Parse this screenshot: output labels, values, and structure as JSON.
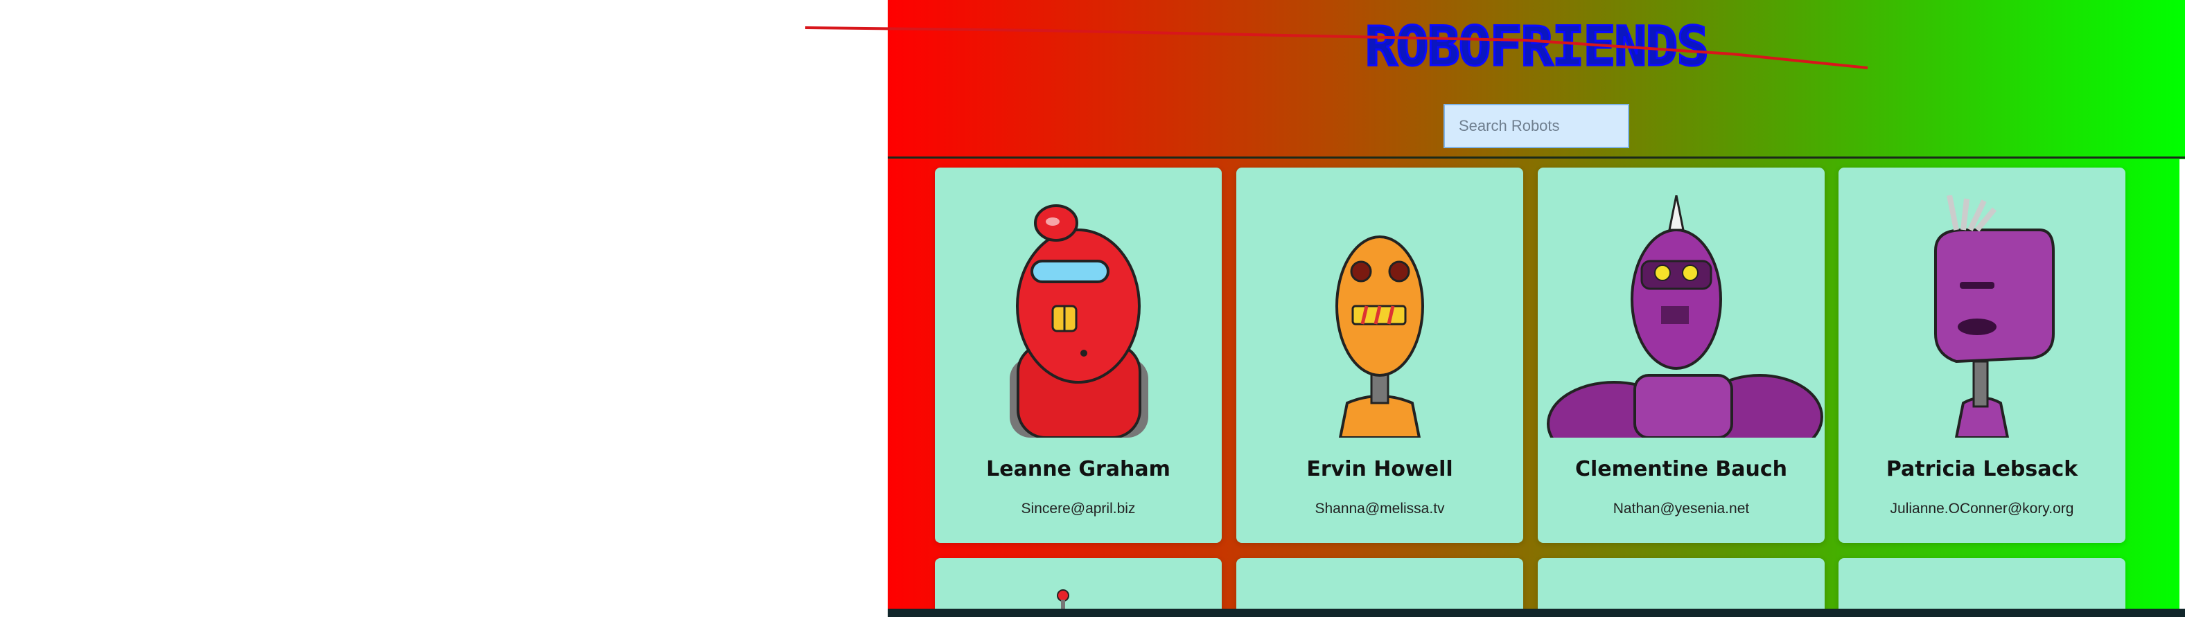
{
  "header": {
    "title": "ROBOFRIENDS",
    "search_placeholder": "Search Robots"
  },
  "cards": [
    {
      "name": "Leanne Graham",
      "email": "Sincere@april.biz"
    },
    {
      "name": "Ervin Howell",
      "email": "Shanna@melissa.tv"
    },
    {
      "name": "Clementine Bauch",
      "email": "Nathan@yesenia.net"
    },
    {
      "name": "Patricia Lebsack",
      "email": "Julianne.OConner@kory.org"
    }
  ],
  "colors": {
    "gradient_left": "#ff0000",
    "gradient_right": "#00ff00",
    "card_bg": "#9febd1",
    "title": "#0b17c0",
    "search_bg": "#d4eafd"
  }
}
